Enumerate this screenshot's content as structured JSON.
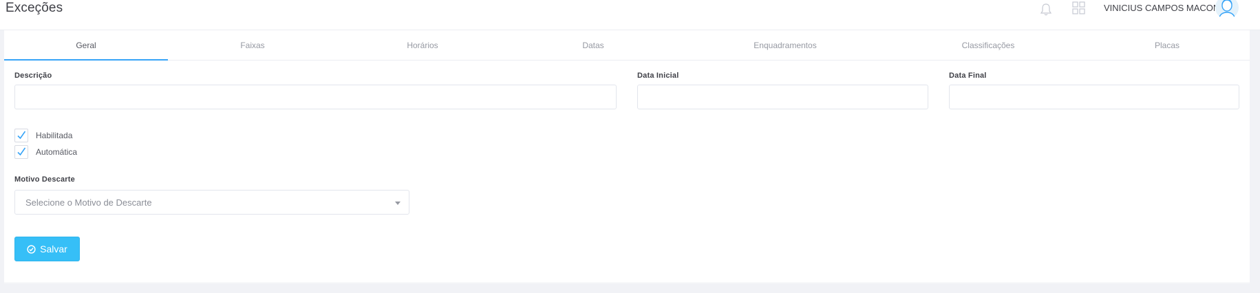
{
  "header": {
    "title": "Exceções",
    "user_name": "VINICIUS CAMPOS MACON",
    "icons": [
      "bell-icon",
      "apps-grid-icon",
      "user-avatar-icon"
    ]
  },
  "tabs": [
    {
      "label": "Geral",
      "active": true
    },
    {
      "label": "Faixas",
      "active": false
    },
    {
      "label": "Horários",
      "active": false
    },
    {
      "label": "Datas",
      "active": false
    },
    {
      "label": "Enquadramentos",
      "active": false
    },
    {
      "label": "Classificações",
      "active": false
    },
    {
      "label": "Placas",
      "active": false
    }
  ],
  "form": {
    "descricao_label": "Descrição",
    "descricao_value": "",
    "data_inicial_label": "Data Inicial",
    "data_inicial_value": "",
    "data_final_label": "Data Final",
    "data_final_value": "",
    "habilitada_label": "Habilitada",
    "habilitada_checked": true,
    "automatica_label": "Automática",
    "automatica_checked": true,
    "motivo_label": "Motivo Descarte",
    "motivo_placeholder": "Selecione o Motivo de Descarte",
    "save_label": "Salvar"
  },
  "colors": {
    "accent": "#36a3f7",
    "button": "#36bff7",
    "check": "#36a3f7"
  }
}
